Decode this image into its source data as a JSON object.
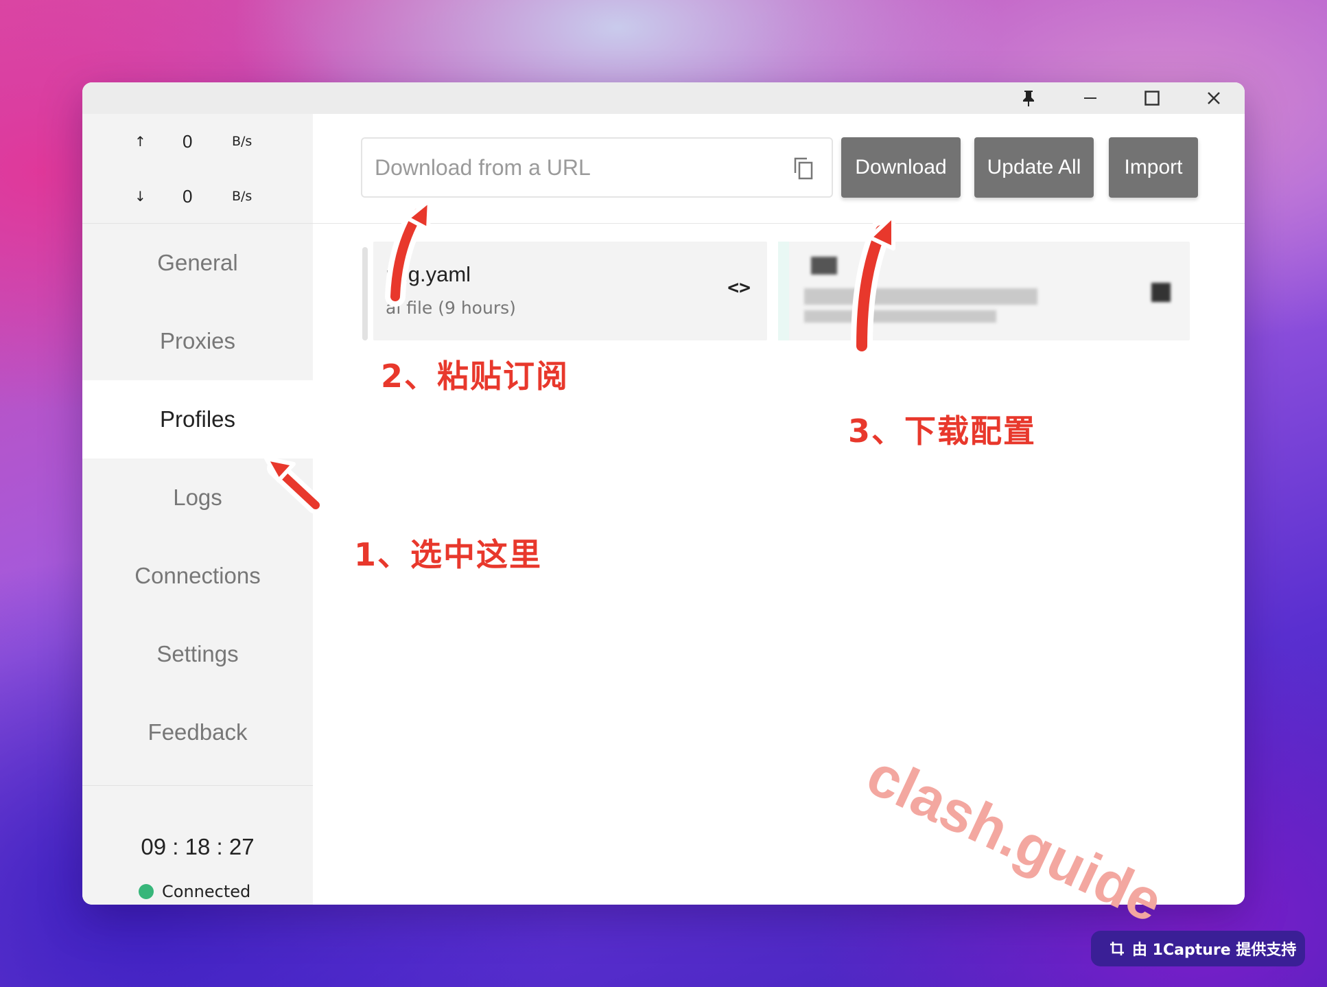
{
  "window": {
    "controls": {
      "pin": "pin-icon",
      "minimize": "minimize-icon",
      "maximize": "maximize-icon",
      "close": "close-icon"
    }
  },
  "sidebar": {
    "traffic": {
      "up_arrow": "↑",
      "up_value": "0",
      "up_unit": "B/s",
      "down_arrow": "↓",
      "down_value": "0",
      "down_unit": "B/s"
    },
    "items": [
      {
        "label": "General"
      },
      {
        "label": "Proxies"
      },
      {
        "label": "Profiles",
        "active": true
      },
      {
        "label": "Logs"
      },
      {
        "label": "Connections"
      },
      {
        "label": "Settings"
      },
      {
        "label": "Feedback"
      }
    ],
    "clock": "09 : 18 : 27",
    "status": "Connected",
    "status_color": "#37b67a"
  },
  "toolbar": {
    "url_placeholder": "Download from a URL",
    "download_label": "Download",
    "update_all_label": "Update All",
    "import_label": "Import"
  },
  "profiles": [
    {
      "name": "nfig.yaml",
      "subtitle": "al file (9 hours)",
      "code_icon": "<>"
    }
  ],
  "annotations": {
    "step1": "1、选中这里",
    "step2": "2、粘贴订阅",
    "step3": "3、下载配置",
    "watermark": "clash.guide",
    "color": "#e8382c"
  },
  "badge": {
    "text": "由 1Capture 提供支持"
  }
}
